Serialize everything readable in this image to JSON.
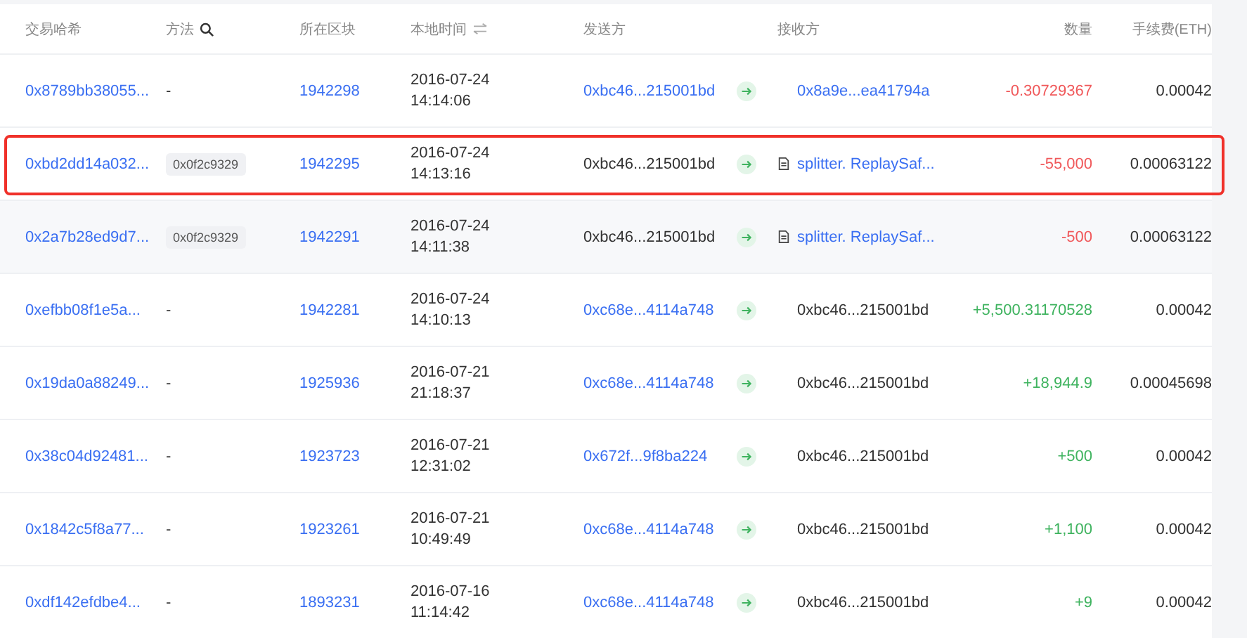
{
  "columns": [
    {
      "label": "交易哈希",
      "kind": "plain"
    },
    {
      "label": "方法",
      "kind": "search"
    },
    {
      "label": "所在区块",
      "kind": "plain"
    },
    {
      "label": "本地时间",
      "kind": "swap"
    },
    {
      "label": "发送方",
      "kind": "plain"
    },
    {
      "label": "接收方",
      "kind": "plain"
    },
    {
      "label": "数量",
      "kind": "plain"
    },
    {
      "label": "手续费(ETH)",
      "kind": "plain"
    }
  ],
  "rows": [
    {
      "hash": "0x8789bb38055...",
      "method": {
        "kind": "none",
        "text": "-"
      },
      "block": "1942298",
      "date": "2016-07-24",
      "time": "14:14:06",
      "from": {
        "kind": "link",
        "text": "0xbc46...215001bd"
      },
      "to": {
        "kind": "link",
        "text": "0x8a9e...ea41794a"
      },
      "amount": {
        "kind": "out",
        "text": "-0.30729367"
      },
      "fee": "0.00042",
      "hovered": false,
      "outlined": false
    },
    {
      "hash": "0xbd2dd14a032...",
      "method": {
        "kind": "badge",
        "text": "0x0f2c9329"
      },
      "block": "1942295",
      "date": "2016-07-24",
      "time": "14:13:16",
      "from": {
        "kind": "plain",
        "text": "0xbc46...215001bd"
      },
      "to": {
        "kind": "contract",
        "text": "splitter. ReplaySaf..."
      },
      "amount": {
        "kind": "out",
        "text": "-55,000"
      },
      "fee": "0.00063122",
      "hovered": false,
      "outlined": true
    },
    {
      "hash": "0x2a7b28ed9d7...",
      "method": {
        "kind": "badge",
        "text": "0x0f2c9329"
      },
      "block": "1942291",
      "date": "2016-07-24",
      "time": "14:11:38",
      "from": {
        "kind": "plain",
        "text": "0xbc46...215001bd"
      },
      "to": {
        "kind": "contract",
        "text": "splitter. ReplaySaf..."
      },
      "amount": {
        "kind": "out",
        "text": "-500"
      },
      "fee": "0.00063122",
      "hovered": true,
      "outlined": false
    },
    {
      "hash": "0xefbb08f1e5a...",
      "method": {
        "kind": "none",
        "text": "-"
      },
      "block": "1942281",
      "date": "2016-07-24",
      "time": "14:10:13",
      "from": {
        "kind": "link",
        "text": "0xc68e...4114a748"
      },
      "to": {
        "kind": "plain",
        "text": "0xbc46...215001bd"
      },
      "amount": {
        "kind": "in",
        "text": "+5,500.31170528"
      },
      "fee": "0.00042",
      "hovered": false,
      "outlined": false
    },
    {
      "hash": "0x19da0a88249...",
      "method": {
        "kind": "none",
        "text": "-"
      },
      "block": "1925936",
      "date": "2016-07-21",
      "time": "21:18:37",
      "from": {
        "kind": "link",
        "text": "0xc68e...4114a748"
      },
      "to": {
        "kind": "plain",
        "text": "0xbc46...215001bd"
      },
      "amount": {
        "kind": "in",
        "text": "+18,944.9"
      },
      "fee": "0.00045698",
      "hovered": false,
      "outlined": false
    },
    {
      "hash": "0x38c04d92481...",
      "method": {
        "kind": "none",
        "text": "-"
      },
      "block": "1923723",
      "date": "2016-07-21",
      "time": "12:31:02",
      "from": {
        "kind": "link",
        "text": "0x672f...9f8ba224"
      },
      "to": {
        "kind": "plain",
        "text": "0xbc46...215001bd"
      },
      "amount": {
        "kind": "in",
        "text": "+500"
      },
      "fee": "0.00042",
      "hovered": false,
      "outlined": false
    },
    {
      "hash": "0x1842c5f8a77...",
      "method": {
        "kind": "none",
        "text": "-"
      },
      "block": "1923261",
      "date": "2016-07-21",
      "time": "10:49:49",
      "from": {
        "kind": "link",
        "text": "0xc68e...4114a748"
      },
      "to": {
        "kind": "plain",
        "text": "0xbc46...215001bd"
      },
      "amount": {
        "kind": "in",
        "text": "+1,100"
      },
      "fee": "0.00042",
      "hovered": false,
      "outlined": false
    },
    {
      "hash": "0xdf142efdbe4...",
      "method": {
        "kind": "none",
        "text": "-"
      },
      "block": "1893231",
      "date": "2016-07-16",
      "time": "11:14:42",
      "from": {
        "kind": "link",
        "text": "0xc68e...4114a748"
      },
      "to": {
        "kind": "plain",
        "text": "0xbc46...215001bd"
      },
      "amount": {
        "kind": "in",
        "text": "+9"
      },
      "fee": "0.00042",
      "hovered": false,
      "outlined": false
    }
  ]
}
